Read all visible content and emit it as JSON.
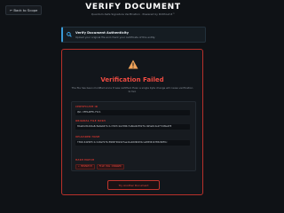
{
  "nav": {
    "back_label": "← Back to Scope"
  },
  "header": {
    "title": "VERIFY DOCUMENT",
    "subtitle": "Quantum-Safe Signature Verification · Powered by Dilithium3™"
  },
  "banner": {
    "icon": "search-icon",
    "title": "Verify Document Authenticity",
    "description": "Upload your original file and check your certificate of this entity."
  },
  "result": {
    "icon": "warning-icon",
    "title": "Verification Failed",
    "description": "The file has been modified since it was certified. Even a single byte change will cause verification to fail.",
    "fields": [
      {
        "label": "CERTIFICATE ID",
        "value": "QSC-5FE1AEF8-F1C1"
      },
      {
        "label": "ORIGINAL FILE HASH",
        "value": "65ab6c81d2ba8c8a0eb6f1c1c7b97c2e7d06c7a6ba94f02f1c4b5e8c2a1f7dd9e4f8"
      },
      {
        "label": "UPLOADED HASH",
        "value": "f3b0c44298fc1c149afbf4c8996fb92427ae41e4649b934ca495991b7852b855c"
      }
    ],
    "status_label": "HASH MATCH",
    "status_values": [
      "✕ MISMATCH",
      "FILE HAS CHANGED"
    ]
  },
  "actions": {
    "retry_label": "Try Another Document"
  },
  "colors": {
    "accent_red": "#ef4b42",
    "accent_blue": "#3fb4ff",
    "bg": "#0f1216"
  }
}
